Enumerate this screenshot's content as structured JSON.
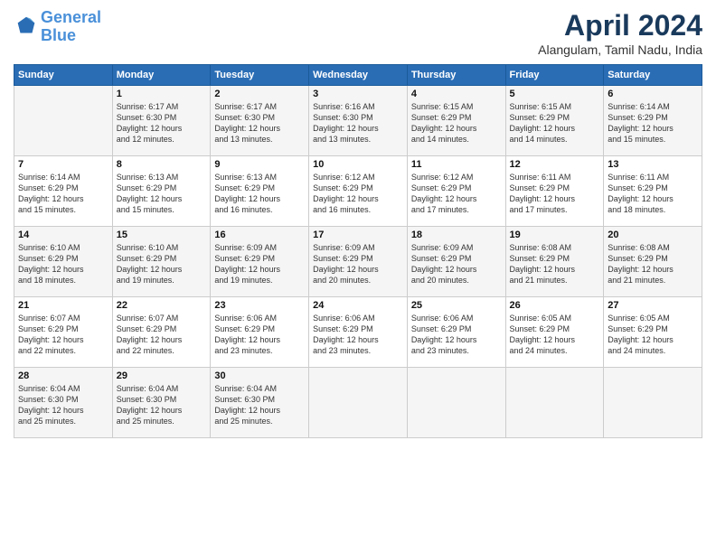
{
  "header": {
    "logo_line1": "General",
    "logo_line2": "Blue",
    "month_title": "April 2024",
    "location": "Alangulam, Tamil Nadu, India"
  },
  "weekdays": [
    "Sunday",
    "Monday",
    "Tuesday",
    "Wednesday",
    "Thursday",
    "Friday",
    "Saturday"
  ],
  "rows": [
    [
      {
        "day": "",
        "info": ""
      },
      {
        "day": "1",
        "info": "Sunrise: 6:17 AM\nSunset: 6:30 PM\nDaylight: 12 hours\nand 12 minutes."
      },
      {
        "day": "2",
        "info": "Sunrise: 6:17 AM\nSunset: 6:30 PM\nDaylight: 12 hours\nand 13 minutes."
      },
      {
        "day": "3",
        "info": "Sunrise: 6:16 AM\nSunset: 6:30 PM\nDaylight: 12 hours\nand 13 minutes."
      },
      {
        "day": "4",
        "info": "Sunrise: 6:15 AM\nSunset: 6:29 PM\nDaylight: 12 hours\nand 14 minutes."
      },
      {
        "day": "5",
        "info": "Sunrise: 6:15 AM\nSunset: 6:29 PM\nDaylight: 12 hours\nand 14 minutes."
      },
      {
        "day": "6",
        "info": "Sunrise: 6:14 AM\nSunset: 6:29 PM\nDaylight: 12 hours\nand 15 minutes."
      }
    ],
    [
      {
        "day": "7",
        "info": "Sunrise: 6:14 AM\nSunset: 6:29 PM\nDaylight: 12 hours\nand 15 minutes."
      },
      {
        "day": "8",
        "info": "Sunrise: 6:13 AM\nSunset: 6:29 PM\nDaylight: 12 hours\nand 15 minutes."
      },
      {
        "day": "9",
        "info": "Sunrise: 6:13 AM\nSunset: 6:29 PM\nDaylight: 12 hours\nand 16 minutes."
      },
      {
        "day": "10",
        "info": "Sunrise: 6:12 AM\nSunset: 6:29 PM\nDaylight: 12 hours\nand 16 minutes."
      },
      {
        "day": "11",
        "info": "Sunrise: 6:12 AM\nSunset: 6:29 PM\nDaylight: 12 hours\nand 17 minutes."
      },
      {
        "day": "12",
        "info": "Sunrise: 6:11 AM\nSunset: 6:29 PM\nDaylight: 12 hours\nand 17 minutes."
      },
      {
        "day": "13",
        "info": "Sunrise: 6:11 AM\nSunset: 6:29 PM\nDaylight: 12 hours\nand 18 minutes."
      }
    ],
    [
      {
        "day": "14",
        "info": "Sunrise: 6:10 AM\nSunset: 6:29 PM\nDaylight: 12 hours\nand 18 minutes."
      },
      {
        "day": "15",
        "info": "Sunrise: 6:10 AM\nSunset: 6:29 PM\nDaylight: 12 hours\nand 19 minutes."
      },
      {
        "day": "16",
        "info": "Sunrise: 6:09 AM\nSunset: 6:29 PM\nDaylight: 12 hours\nand 19 minutes."
      },
      {
        "day": "17",
        "info": "Sunrise: 6:09 AM\nSunset: 6:29 PM\nDaylight: 12 hours\nand 20 minutes."
      },
      {
        "day": "18",
        "info": "Sunrise: 6:09 AM\nSunset: 6:29 PM\nDaylight: 12 hours\nand 20 minutes."
      },
      {
        "day": "19",
        "info": "Sunrise: 6:08 AM\nSunset: 6:29 PM\nDaylight: 12 hours\nand 21 minutes."
      },
      {
        "day": "20",
        "info": "Sunrise: 6:08 AM\nSunset: 6:29 PM\nDaylight: 12 hours\nand 21 minutes."
      }
    ],
    [
      {
        "day": "21",
        "info": "Sunrise: 6:07 AM\nSunset: 6:29 PM\nDaylight: 12 hours\nand 22 minutes."
      },
      {
        "day": "22",
        "info": "Sunrise: 6:07 AM\nSunset: 6:29 PM\nDaylight: 12 hours\nand 22 minutes."
      },
      {
        "day": "23",
        "info": "Sunrise: 6:06 AM\nSunset: 6:29 PM\nDaylight: 12 hours\nand 23 minutes."
      },
      {
        "day": "24",
        "info": "Sunrise: 6:06 AM\nSunset: 6:29 PM\nDaylight: 12 hours\nand 23 minutes."
      },
      {
        "day": "25",
        "info": "Sunrise: 6:06 AM\nSunset: 6:29 PM\nDaylight: 12 hours\nand 23 minutes."
      },
      {
        "day": "26",
        "info": "Sunrise: 6:05 AM\nSunset: 6:29 PM\nDaylight: 12 hours\nand 24 minutes."
      },
      {
        "day": "27",
        "info": "Sunrise: 6:05 AM\nSunset: 6:29 PM\nDaylight: 12 hours\nand 24 minutes."
      }
    ],
    [
      {
        "day": "28",
        "info": "Sunrise: 6:04 AM\nSunset: 6:30 PM\nDaylight: 12 hours\nand 25 minutes."
      },
      {
        "day": "29",
        "info": "Sunrise: 6:04 AM\nSunset: 6:30 PM\nDaylight: 12 hours\nand 25 minutes."
      },
      {
        "day": "30",
        "info": "Sunrise: 6:04 AM\nSunset: 6:30 PM\nDaylight: 12 hours\nand 25 minutes."
      },
      {
        "day": "",
        "info": ""
      },
      {
        "day": "",
        "info": ""
      },
      {
        "day": "",
        "info": ""
      },
      {
        "day": "",
        "info": ""
      }
    ]
  ]
}
